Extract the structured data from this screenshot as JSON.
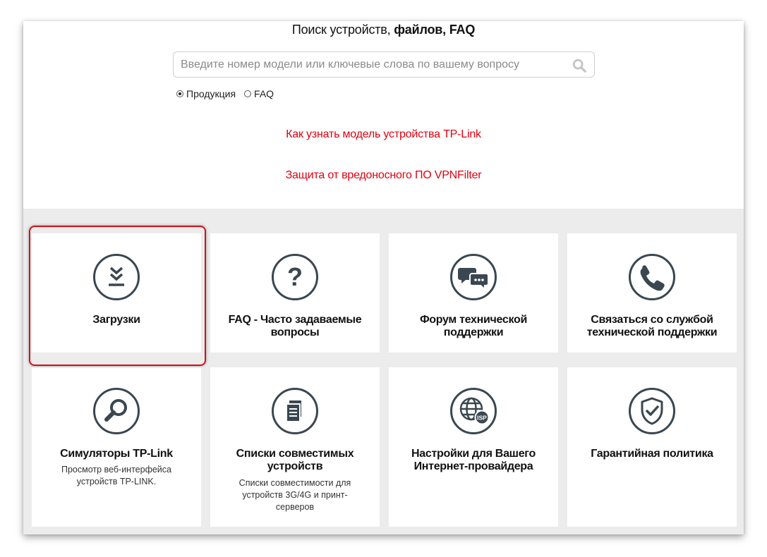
{
  "search": {
    "title_regular": "Поиск устройств, ",
    "title_bold": "файлов, FAQ",
    "placeholder": "Введите номер модели или ключевые слова по вашему вопросу",
    "icon": "search-icon",
    "radio_products": "Продукция",
    "radio_faq": "FAQ",
    "selected": "Продукция"
  },
  "links": {
    "how_to_find_model": "Как узнать модель устройства TP-Link",
    "vpnfilter": "Защита от вредоносного ПО VPNFilter"
  },
  "colors": {
    "accent_red": "#e00010",
    "icon_dark": "#3a4750",
    "grid_bg": "#ececec"
  },
  "cards": [
    {
      "title": "Загрузки",
      "subtitle": "",
      "icon": "download-icon"
    },
    {
      "title": "FAQ - Часто задаваемые вопросы",
      "subtitle": "",
      "icon": "question-icon"
    },
    {
      "title": "Форум технической поддержки",
      "subtitle": "",
      "icon": "chat-bubbles-icon"
    },
    {
      "title": "Связаться со службой технической поддержки",
      "subtitle": "",
      "icon": "phone-icon"
    },
    {
      "title": "Симуляторы TP-Link",
      "subtitle": "Просмотр веб-интерфейса устройств TP-LINK.",
      "icon": "magnifier-icon"
    },
    {
      "title": "Списки совместимых устройств",
      "subtitle": "Списки совместимости для устройств 3G/4G и принт-серверов",
      "icon": "document-list-icon"
    },
    {
      "title": "Настройки для Вашего Интернет-провайдера",
      "subtitle": "",
      "icon": "globe-isp-icon",
      "badge": "ISP"
    },
    {
      "title": "Гарантийная политика",
      "subtitle": "",
      "icon": "shield-check-icon"
    }
  ]
}
